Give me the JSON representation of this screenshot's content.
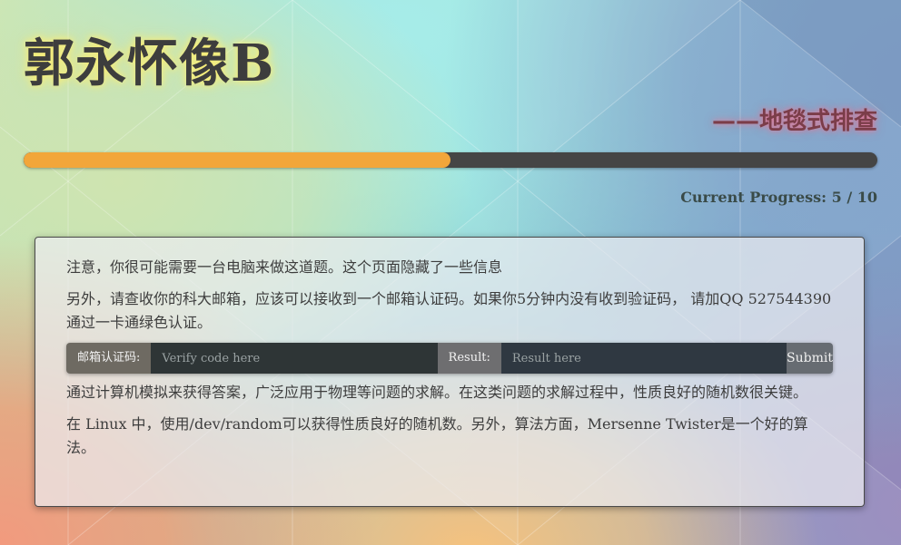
{
  "header": {
    "title": "郭永怀像B",
    "subtitle": "——地毯式排查"
  },
  "progress": {
    "current": 5,
    "total": 10,
    "text": "Current Progress: 5 / 10",
    "fill_color": "#f2a63a",
    "track_color": "#454545"
  },
  "content": {
    "paragraph1": "注意，你很可能需要一台电脑来做这道题。这个页面隐藏了一些信息",
    "paragraph2": "另外，请查收你的科大邮箱，应该可以接收到一个邮箱认证码。如果你5分钟内没有收到验证码， 请加QQ 527544390通过一卡通绿色认证。",
    "paragraph3": "通过计算机模拟来获得答案，广泛应用于物理等问题的求解。在这类问题的求解过程中，性质良好的随机数很关键。",
    "paragraph4": "在 Linux 中，使用/dev/random可以获得性质良好的随机数。另外，算法方面，Mersenne Twister是一个好的算法。"
  },
  "form": {
    "code_label": "邮箱认证码:",
    "code_placeholder": "Verify code here",
    "code_value": "",
    "result_label": "Result:",
    "result_placeholder": "Result here",
    "result_value": "",
    "submit_label": "Submit"
  }
}
